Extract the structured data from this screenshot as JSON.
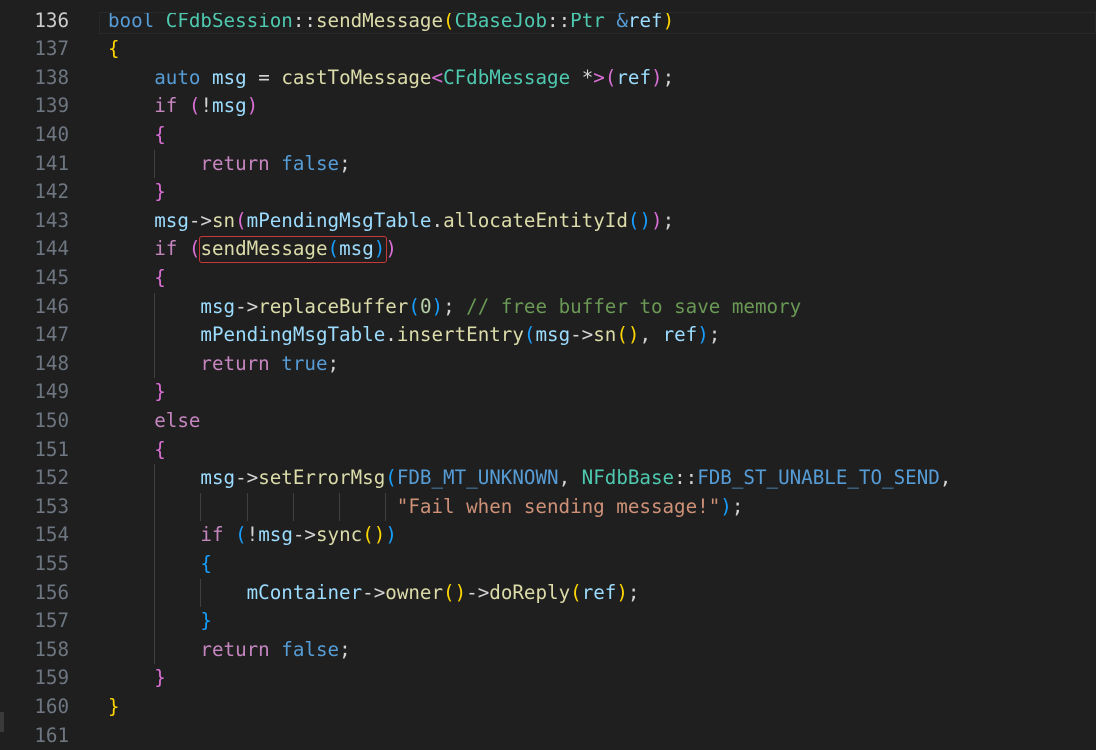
{
  "editor": {
    "current_line": 136,
    "lines": [
      {
        "n": 136,
        "tokens": [
          [
            "bool",
            "kw"
          ],
          [
            " ",
            "op"
          ],
          [
            "CFdbSession",
            "ty"
          ],
          [
            "::",
            "op"
          ],
          [
            "sendMessage",
            "fn"
          ],
          [
            "(",
            "b1"
          ],
          [
            "CBaseJob",
            "ty"
          ],
          [
            "::",
            "op"
          ],
          [
            "Ptr",
            "ty"
          ],
          [
            " ",
            "op"
          ],
          [
            "&",
            "kw"
          ],
          [
            "ref",
            "var"
          ],
          [
            ")",
            "b1"
          ]
        ]
      },
      {
        "n": 137,
        "tokens": [
          [
            "{",
            "b1"
          ]
        ]
      },
      {
        "n": 138,
        "tokens": [
          [
            "    ",
            "op"
          ],
          [
            "auto",
            "kw"
          ],
          [
            " ",
            "op"
          ],
          [
            "msg",
            "var"
          ],
          [
            " = ",
            "op"
          ],
          [
            "castToMessage",
            "fn"
          ],
          [
            "<",
            "b2"
          ],
          [
            "CFdbMessage",
            "ty"
          ],
          [
            " *",
            "op"
          ],
          [
            ">",
            "b2"
          ],
          [
            "(",
            "b2"
          ],
          [
            "ref",
            "var"
          ],
          [
            ")",
            "b2"
          ],
          [
            ";",
            "op"
          ]
        ]
      },
      {
        "n": 139,
        "tokens": [
          [
            "    ",
            "op"
          ],
          [
            "if",
            "ctl"
          ],
          [
            " ",
            "op"
          ],
          [
            "(",
            "b2"
          ],
          [
            "!",
            "op"
          ],
          [
            "msg",
            "var"
          ],
          [
            ")",
            "b2"
          ]
        ]
      },
      {
        "n": 140,
        "tokens": [
          [
            "    ",
            "op"
          ],
          [
            "{",
            "b2"
          ]
        ]
      },
      {
        "n": 141,
        "tokens": [
          [
            "        ",
            "op"
          ],
          [
            "return",
            "ctl"
          ],
          [
            " ",
            "op"
          ],
          [
            "false",
            "kw"
          ],
          [
            ";",
            "op"
          ]
        ]
      },
      {
        "n": 142,
        "tokens": [
          [
            "    ",
            "op"
          ],
          [
            "}",
            "b2"
          ]
        ]
      },
      {
        "n": 143,
        "tokens": [
          [
            "    ",
            "op"
          ],
          [
            "msg",
            "var"
          ],
          [
            "->",
            "op"
          ],
          [
            "sn",
            "fn"
          ],
          [
            "(",
            "b2"
          ],
          [
            "mPendingMsgTable",
            "var"
          ],
          [
            ".",
            "op"
          ],
          [
            "allocateEntityId",
            "fn"
          ],
          [
            "(",
            "b3"
          ],
          [
            ")",
            "b3"
          ],
          [
            ")",
            "b2"
          ],
          [
            ";",
            "op"
          ]
        ]
      },
      {
        "n": 144,
        "tokens": [
          [
            "    ",
            "op"
          ],
          [
            "if",
            "ctl"
          ],
          [
            " ",
            "op"
          ],
          [
            "(",
            "b2"
          ],
          [
            "sendMessage",
            "fn"
          ],
          [
            "(",
            "b3"
          ],
          [
            "msg",
            "var"
          ],
          [
            ")",
            "b3"
          ],
          [
            ")",
            "b2"
          ]
        ]
      },
      {
        "n": 145,
        "tokens": [
          [
            "    ",
            "op"
          ],
          [
            "{",
            "b2"
          ]
        ]
      },
      {
        "n": 146,
        "tokens": [
          [
            "        ",
            "op"
          ],
          [
            "msg",
            "var"
          ],
          [
            "->",
            "op"
          ],
          [
            "replaceBuffer",
            "fn"
          ],
          [
            "(",
            "b3"
          ],
          [
            "0",
            "num"
          ],
          [
            ")",
            "b3"
          ],
          [
            "; ",
            "op"
          ],
          [
            "// free buffer to save memory",
            "cm"
          ]
        ]
      },
      {
        "n": 147,
        "tokens": [
          [
            "        ",
            "op"
          ],
          [
            "mPendingMsgTable",
            "var"
          ],
          [
            ".",
            "op"
          ],
          [
            "insertEntry",
            "fn"
          ],
          [
            "(",
            "b3"
          ],
          [
            "msg",
            "var"
          ],
          [
            "->",
            "op"
          ],
          [
            "sn",
            "fn"
          ],
          [
            "(",
            "b1"
          ],
          [
            ")",
            "b1"
          ],
          [
            ", ",
            "op"
          ],
          [
            "ref",
            "var"
          ],
          [
            ")",
            "b3"
          ],
          [
            ";",
            "op"
          ]
        ]
      },
      {
        "n": 148,
        "tokens": [
          [
            "        ",
            "op"
          ],
          [
            "return",
            "ctl"
          ],
          [
            " ",
            "op"
          ],
          [
            "true",
            "kw"
          ],
          [
            ";",
            "op"
          ]
        ]
      },
      {
        "n": 149,
        "tokens": [
          [
            "    ",
            "op"
          ],
          [
            "}",
            "b2"
          ]
        ]
      },
      {
        "n": 150,
        "tokens": [
          [
            "    ",
            "op"
          ],
          [
            "else",
            "ctl"
          ]
        ]
      },
      {
        "n": 151,
        "tokens": [
          [
            "    ",
            "op"
          ],
          [
            "{",
            "b2"
          ]
        ]
      },
      {
        "n": 152,
        "tokens": [
          [
            "        ",
            "op"
          ],
          [
            "msg",
            "var"
          ],
          [
            "->",
            "op"
          ],
          [
            "setErrorMsg",
            "fn"
          ],
          [
            "(",
            "b3"
          ],
          [
            "FDB_MT_UNKNOWN",
            "kw"
          ],
          [
            ", ",
            "op"
          ],
          [
            "NFdbBase",
            "ty"
          ],
          [
            "::",
            "op"
          ],
          [
            "FDB_ST_UNABLE_TO_SEND",
            "kw"
          ],
          [
            ",",
            "op"
          ]
        ]
      },
      {
        "n": 153,
        "tokens": [
          [
            "                         ",
            "op"
          ],
          [
            "\"Fail when sending message!\"",
            "str"
          ],
          [
            ")",
            "b3"
          ],
          [
            ";",
            "op"
          ]
        ]
      },
      {
        "n": 154,
        "tokens": [
          [
            "        ",
            "op"
          ],
          [
            "if",
            "ctl"
          ],
          [
            " ",
            "op"
          ],
          [
            "(",
            "b3"
          ],
          [
            "!",
            "op"
          ],
          [
            "msg",
            "var"
          ],
          [
            "->",
            "op"
          ],
          [
            "sync",
            "fn"
          ],
          [
            "(",
            "b1"
          ],
          [
            ")",
            "b1"
          ],
          [
            ")",
            "b3"
          ]
        ]
      },
      {
        "n": 155,
        "tokens": [
          [
            "        ",
            "op"
          ],
          [
            "{",
            "b3"
          ]
        ]
      },
      {
        "n": 156,
        "tokens": [
          [
            "            ",
            "op"
          ],
          [
            "mContainer",
            "var"
          ],
          [
            "->",
            "op"
          ],
          [
            "owner",
            "fn"
          ],
          [
            "(",
            "b1"
          ],
          [
            ")",
            "b1"
          ],
          [
            "->",
            "op"
          ],
          [
            "doReply",
            "fn"
          ],
          [
            "(",
            "b1"
          ],
          [
            "ref",
            "var"
          ],
          [
            ")",
            "b1"
          ],
          [
            ";",
            "op"
          ]
        ]
      },
      {
        "n": 157,
        "tokens": [
          [
            "        ",
            "op"
          ],
          [
            "}",
            "b3"
          ]
        ]
      },
      {
        "n": 158,
        "tokens": [
          [
            "        ",
            "op"
          ],
          [
            "return",
            "ctl"
          ],
          [
            " ",
            "op"
          ],
          [
            "false",
            "kw"
          ],
          [
            ";",
            "op"
          ]
        ]
      },
      {
        "n": 159,
        "tokens": [
          [
            "    ",
            "op"
          ],
          [
            "}",
            "b2"
          ]
        ]
      },
      {
        "n": 160,
        "tokens": [
          [
            "}",
            "b1"
          ]
        ]
      },
      {
        "n": 161,
        "tokens": []
      }
    ]
  }
}
